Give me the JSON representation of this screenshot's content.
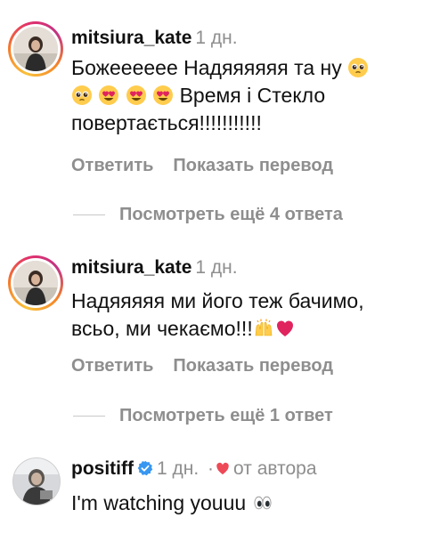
{
  "comments": [
    {
      "username": "mitsiura_kate",
      "time": "1 дн.",
      "text_line1": "Божееееее Надяяяяяя та ну",
      "text_line2_suffix": "Время і Стекло",
      "text_line3": "повертається!!!!!!!!!!!",
      "emoji_line1": "pleading-face",
      "emoji_line2": [
        "pleading-face",
        "heart-eyes",
        "heart-eyes",
        "heart-eyes"
      ],
      "reply_label": "Ответить",
      "translate_label": "Показать перевод",
      "view_replies_label": "Посмотреть ещё 4 ответа"
    },
    {
      "username": "mitsiura_kate",
      "time": "1 дн.",
      "text_line1": "Надяяяяя ми його теж бачимо,",
      "text_line2": "всьо, ми чекаємо!!!",
      "emoji_line2": [
        "raising-hands",
        "red-heart"
      ],
      "reply_label": "Ответить",
      "translate_label": "Показать перевод",
      "view_replies_label": "Посмотреть ещё 1 ответ"
    },
    {
      "username": "positiff",
      "verified": true,
      "time": "1 дн.",
      "separator": "·",
      "by_author_label": "от автора",
      "text_line1": "I'm watching youuu",
      "emoji_line1": "eyes"
    }
  ],
  "colors": {
    "text": "#111111",
    "secondary": "#8e8e8e",
    "verified_blue": "#3897f0",
    "heart_red": "#ed4956"
  }
}
